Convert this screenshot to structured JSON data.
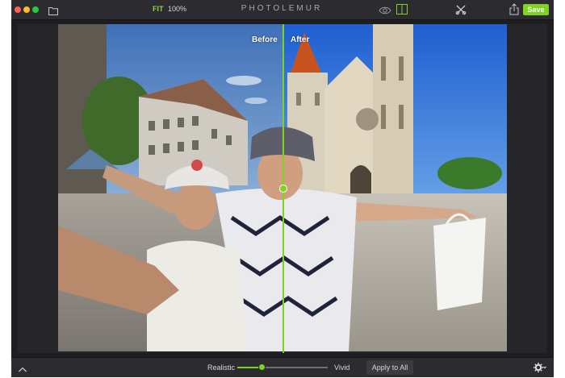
{
  "toolbar": {
    "fit_label": "FIT",
    "zoom_label": "100%",
    "app_title": "PHOTOLEMUR",
    "save_label": "Save",
    "icons": [
      "folder-icon",
      "eye-icon",
      "split-view-icon",
      "tools-icon",
      "share-icon"
    ]
  },
  "compare": {
    "before_label": "Before",
    "after_label": "After"
  },
  "bottombar": {
    "realistic_label": "Realistic",
    "vivid_label": "Vivid",
    "apply_label": "Apply to All",
    "slider_value": 0.27,
    "icons": [
      "chevron-up-icon",
      "gear-icon"
    ]
  },
  "colors": {
    "accent": "#7ed321",
    "toolbar_bg": "#2b2b30",
    "canvas_bg": "#25252a"
  }
}
